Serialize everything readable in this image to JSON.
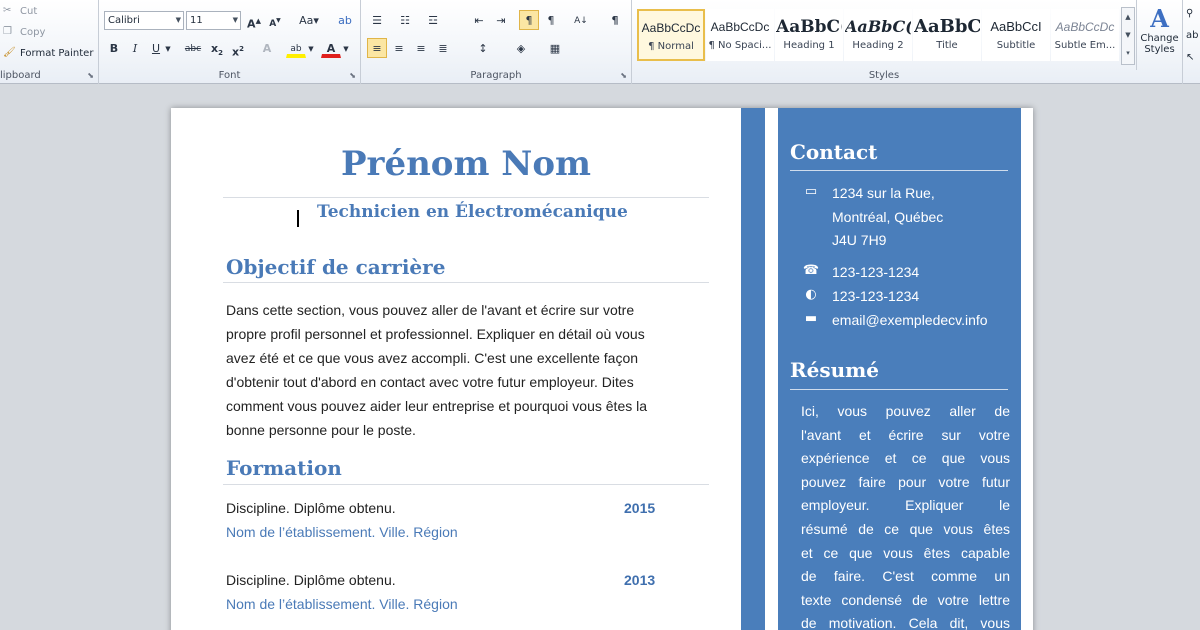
{
  "ribbon": {
    "clipboard": {
      "cut": "Cut",
      "copy": "Copy",
      "format_painter": "Format Painter",
      "label": "lipboard"
    },
    "font": {
      "family": "Calibri",
      "size": "11",
      "label": "Font"
    },
    "paragraph": {
      "label": "Paragraph"
    },
    "styles": {
      "label": "Styles",
      "items": [
        {
          "sample": "AaBbCcDc",
          "name": "¶ Normal"
        },
        {
          "sample": "AaBbCcDc",
          "name": "¶ No Spaci..."
        },
        {
          "sample": "AaBbC(",
          "name": "Heading 1"
        },
        {
          "sample": "AaBbC(",
          "name": "Heading 2"
        },
        {
          "sample": "AaBbC",
          "name": "Title"
        },
        {
          "sample": "AaBbCcI",
          "name": "Subtitle"
        },
        {
          "sample": "AaBbCcDc",
          "name": "Subtle Em..."
        }
      ],
      "change_styles_1": "Change",
      "change_styles_2": "Styles"
    }
  },
  "document": {
    "name": "Prénom Nom",
    "job_title": "Technicien en Électromécanique",
    "objective_heading": "Objectif de carrière",
    "objective_lines": [
      "Dans cette section, vous pouvez aller de l'avant et écrire sur votre",
      "propre profil personnel et professionnel. Expliquer en détail où vous",
      "avez été et ce que vous avez accompli. C'est une excellente façon",
      "d'obtenir tout d'abord en contact avec votre futur employeur. Dites",
      "comment vous pouvez aider leur entreprise et pourquoi vous êtes la",
      "bonne personne pour le poste."
    ],
    "education_heading": "Formation",
    "education": [
      {
        "line": "Discipline. Diplôme obtenu.",
        "school": "Nom de l’établissement. Ville. Région",
        "year": "2015"
      },
      {
        "line": "Discipline. Diplôme obtenu.",
        "school": "Nom de l’établissement. Ville. Région",
        "year": "2013"
      }
    ],
    "sidebar": {
      "contact_heading": "Contact",
      "address_lines": [
        "1234 sur la Rue,",
        "Montréal, Québec",
        "J4U 7H9"
      ],
      "phone": "123-123-1234",
      "mobile": "123-123-1234",
      "email": "email@exempledecv.info",
      "resume_heading": "Résumé",
      "resume_lines": [
        "Ici, vous pouvez aller de",
        "l'avant et écrire sur votre",
        "expérience et ce que vous",
        "pouvez faire pour votre futur",
        "employeur. Expliquer le",
        "résumé de ce que vous êtes",
        "et ce que vous êtes capable",
        "de faire. C'est comme un",
        "texte condensé de votre lettre",
        "de motivation. Cela dit, vous"
      ]
    }
  },
  "colors": {
    "accent": "#4a7ab7",
    "sidebar": "#4a7ebb"
  }
}
